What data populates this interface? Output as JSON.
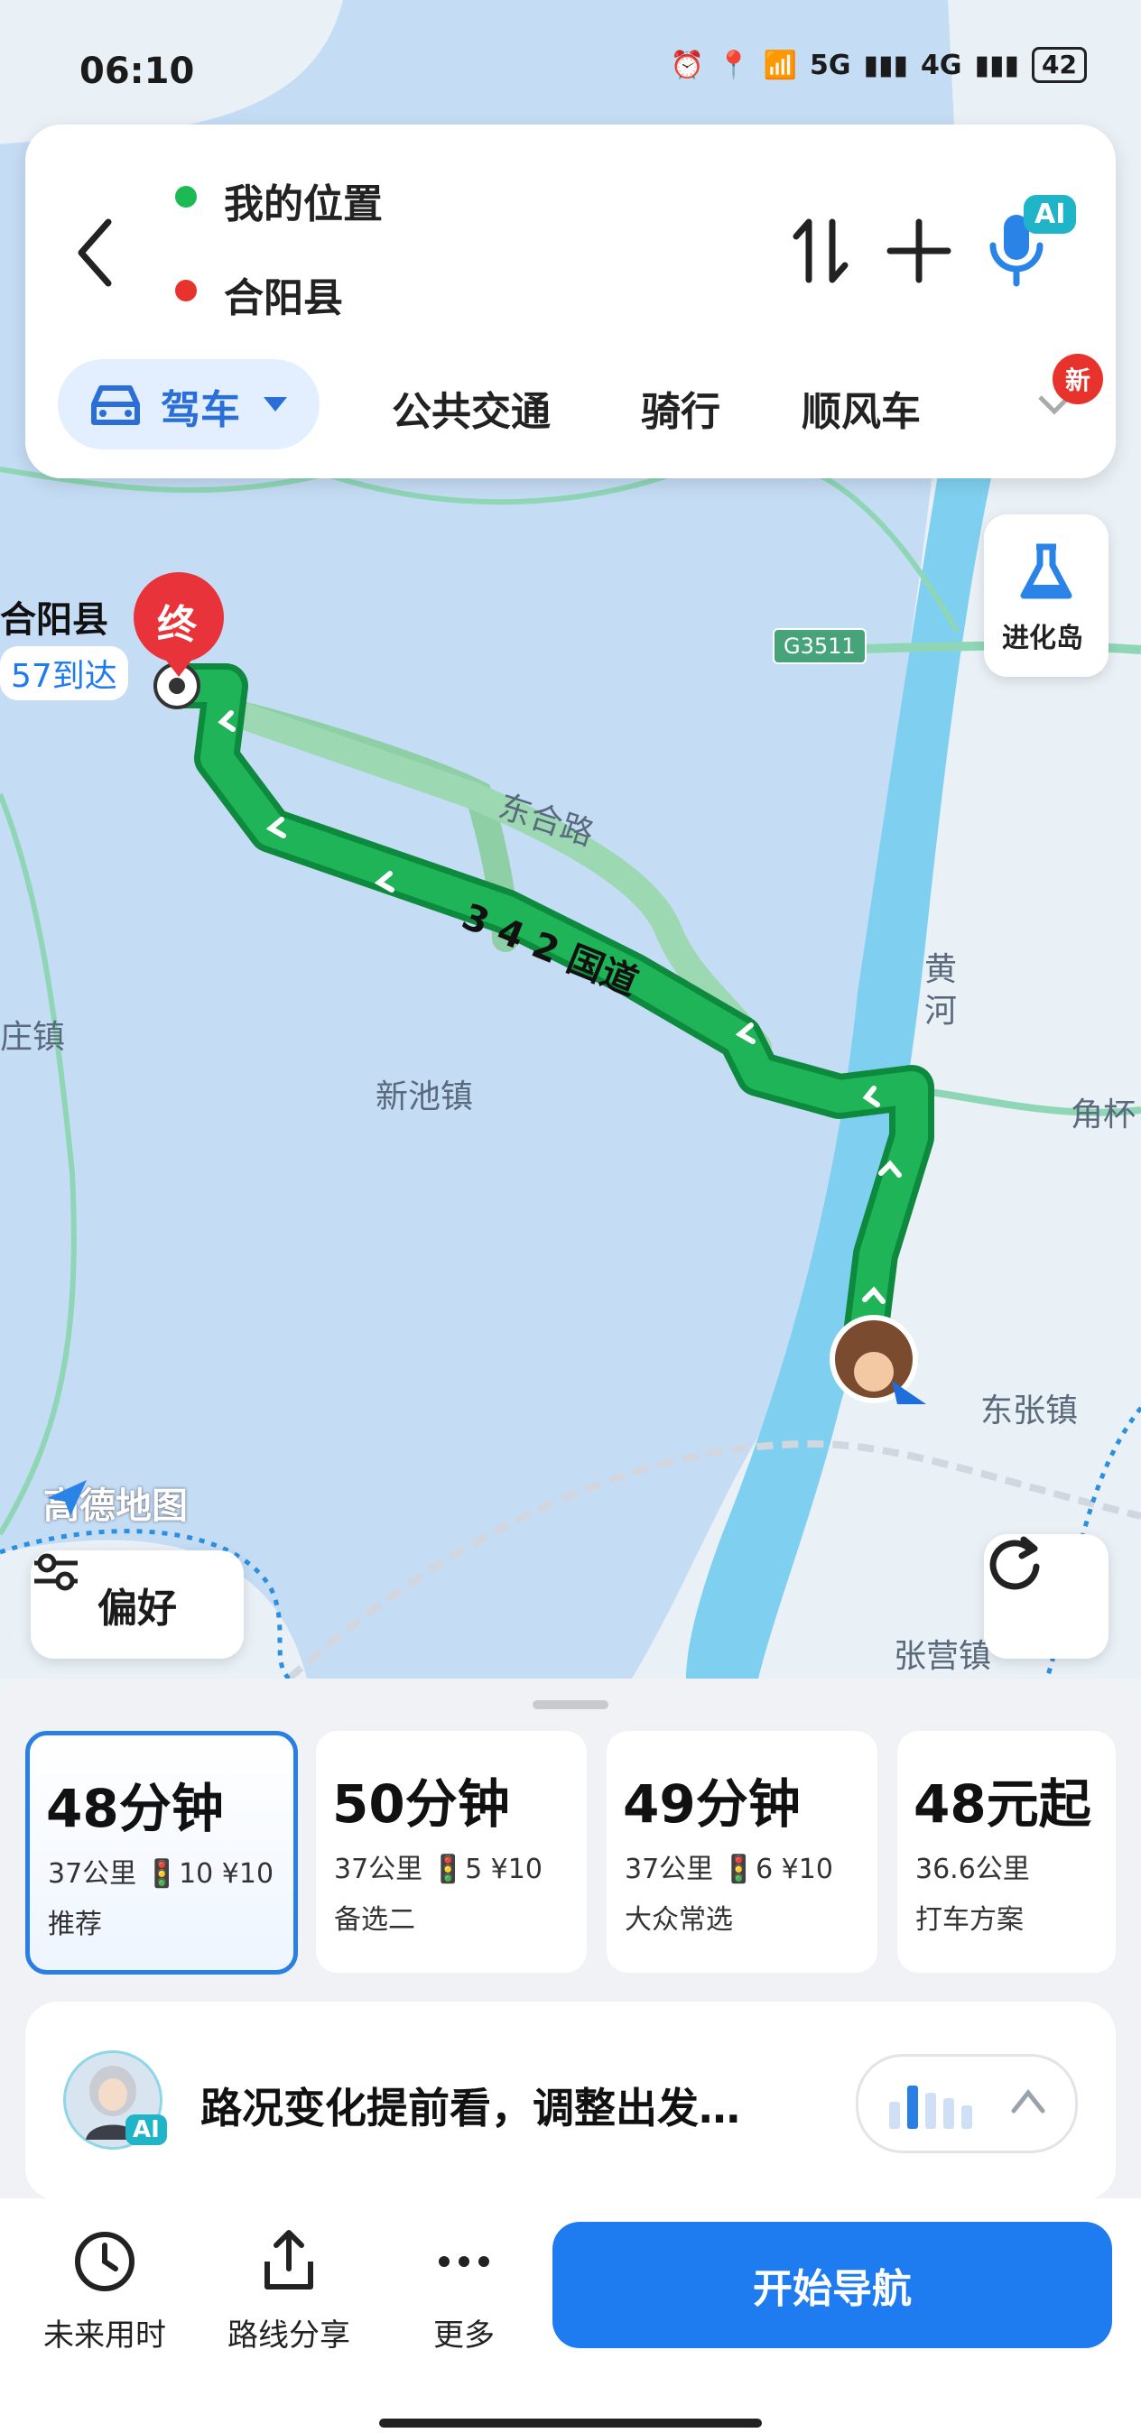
{
  "status_bar": {
    "time": "06:10",
    "network_1": "5G",
    "network_2": "4G",
    "battery": "42"
  },
  "route_card": {
    "origin": "我的位置",
    "destination": "合阳县",
    "origin_color": "#1db954",
    "destination_color": "#e8332c",
    "modes": [
      {
        "label": "驾车",
        "selected": true
      },
      {
        "label": "公共交通"
      },
      {
        "label": "骑行"
      },
      {
        "label": "顺风车"
      }
    ],
    "new_badge": "新",
    "ai_badge": "AI"
  },
  "map": {
    "destination_name": "合阳县",
    "destination_eta": "57到达",
    "end_marker": "终",
    "highway_shield": "G3511",
    "road_label_1": "东合路",
    "road_label_2": "3 4 2 国道",
    "place_1": "新池镇",
    "place_2": "东张镇",
    "place_3": "张营镇",
    "place_4": "角杯",
    "place_5": "庄镇",
    "river_label": "黄河",
    "watermark": "高德地图",
    "evolution_island": "进化岛",
    "preference_btn": "偏好",
    "route_color": "#1fb457"
  },
  "route_options": [
    {
      "time": "48分钟",
      "detail": "37公里 🚦10 ¥10",
      "tag": "推荐",
      "selected": true
    },
    {
      "time": "50分钟",
      "detail": "37公里 🚦5 ¥10",
      "tag": "备选二"
    },
    {
      "time": "49分钟",
      "detail": "37公里 🚦6 ¥10",
      "tag": "大众常选"
    },
    {
      "time": "48元起",
      "detail": "36.6公里",
      "tag": "打车方案"
    }
  ],
  "ai_card": {
    "text": "路况变化提前看，调整出发…",
    "avatar_badge": "AI"
  },
  "bottom_bar": {
    "future_time": "未来用时",
    "share": "路线分享",
    "more": "更多",
    "start_nav": "开始导航"
  }
}
